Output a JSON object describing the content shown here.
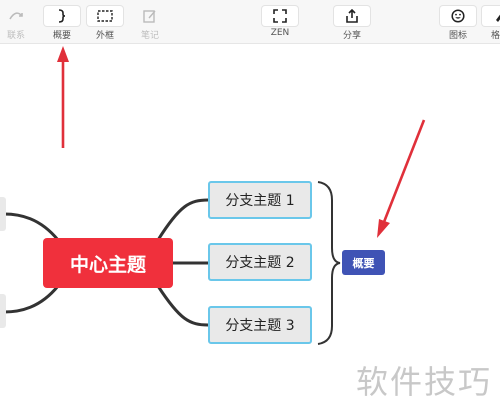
{
  "toolbar": {
    "items": [
      {
        "label": "联系",
        "icon": "relationship-icon",
        "disabled": true
      },
      {
        "label": "概要",
        "icon": "summary-brace-icon",
        "disabled": false
      },
      {
        "label": "外框",
        "icon": "boundary-icon",
        "disabled": false
      },
      {
        "label": "笔记",
        "icon": "note-icon",
        "disabled": true
      },
      {
        "label": "ZEN",
        "icon": "zen-fullscreen-icon",
        "disabled": false
      },
      {
        "label": "分享",
        "icon": "share-icon",
        "disabled": false
      },
      {
        "label": "图标",
        "icon": "emoji-icon",
        "disabled": false
      },
      {
        "label": "格式",
        "icon": "format-brush-icon",
        "disabled": false
      }
    ]
  },
  "mindmap": {
    "central": "中心主题",
    "subtopics": [
      "分支主题 1",
      "分支主题 2",
      "分支主题 3"
    ],
    "summary": "概要"
  },
  "watermark": "软件技巧",
  "colors": {
    "central": "#f0303c",
    "subtopic_border": "#6ac7ea",
    "summary": "#3f53b5",
    "arrow": "#e0303a"
  }
}
